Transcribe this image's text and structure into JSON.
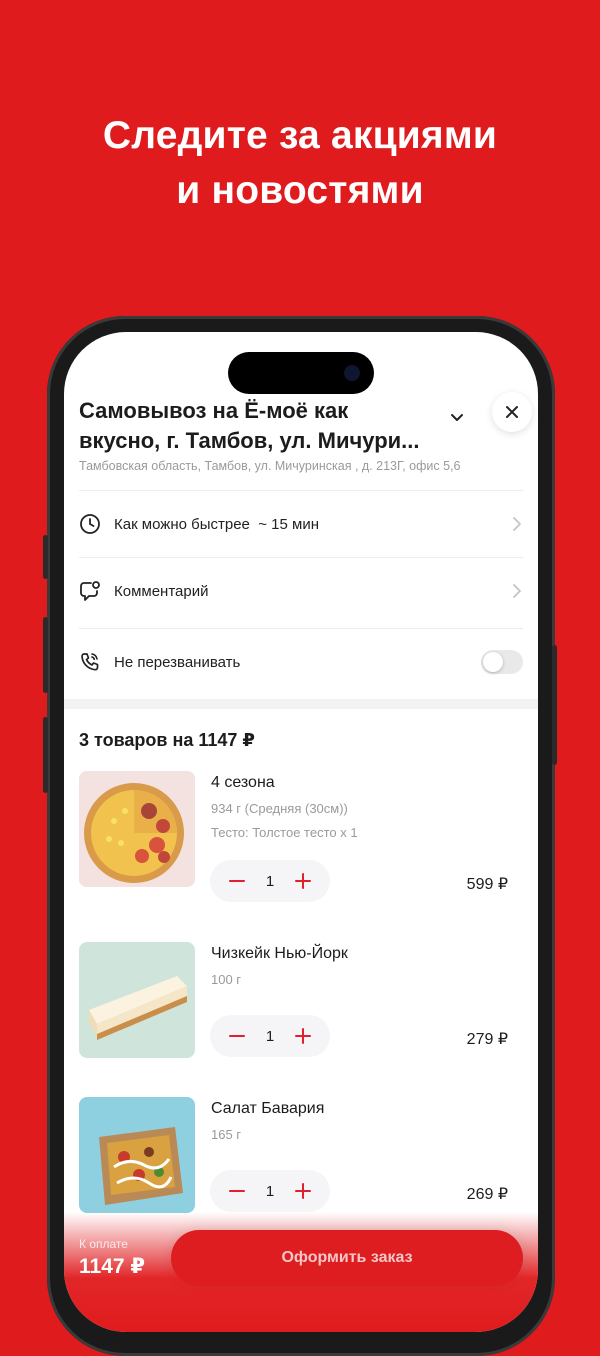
{
  "promo": {
    "line1": "Следите за акциями",
    "line2": "и новостями"
  },
  "order": {
    "pickup_title_line1": "Самовывоз на Ё-моё как",
    "pickup_title_line2": "вкусно, г. Тамбов, ул. Мичури...",
    "address": "Тамбовская область, Тамбов, ул. Мичуринская , д. 213Г, офис 5,6",
    "time_label": "Как можно быстрее",
    "time_estimate": "~ 15 мин",
    "comment_label": "Комментарий",
    "no_call_label": "Не перезванивать",
    "no_call_enabled": false
  },
  "cart": {
    "summary": "3 товаров на 1147 ₽",
    "items": [
      {
        "name": "4 сезона",
        "weight": "934 г (Средняя (30см))",
        "option": "Тесто: Толстое тесто x 1",
        "qty": "1",
        "price": "599 ₽"
      },
      {
        "name": "Чизкейк Нью-Йорк",
        "weight": "100 г",
        "qty": "1",
        "price": "279 ₽"
      },
      {
        "name": "Салат Бавария",
        "weight": "165 г",
        "qty": "1",
        "price": "269 ₽"
      }
    ]
  },
  "checkout": {
    "total_label": "К оплате",
    "total_value": "1147 ₽",
    "button_label": "Оформить заказ"
  },
  "colors": {
    "brand_red": "#e01b1d",
    "accent": "#e0202a"
  }
}
